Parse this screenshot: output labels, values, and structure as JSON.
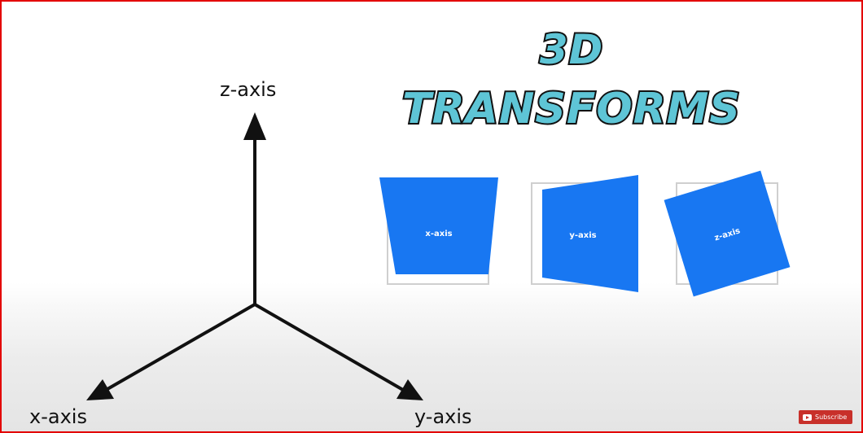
{
  "axes_diagram": {
    "z_label": "z-axis",
    "x_label": "x-axis",
    "y_label": "y-axis"
  },
  "title": {
    "line1": "3D",
    "line2": "TRANSFORMS",
    "fill_color": "#5ec5d6",
    "stroke_color": "#111111"
  },
  "demos": [
    {
      "label": "x-axis",
      "color": "#1877f2"
    },
    {
      "label": "y-axis",
      "color": "#1877f2"
    },
    {
      "label": "z-axis",
      "color": "#1877f2"
    }
  ],
  "subscribe": {
    "label": "Subscribe",
    "icon": "youtube-play-icon",
    "color": "#c8302a"
  },
  "frame": {
    "border_color": "#e30000"
  }
}
